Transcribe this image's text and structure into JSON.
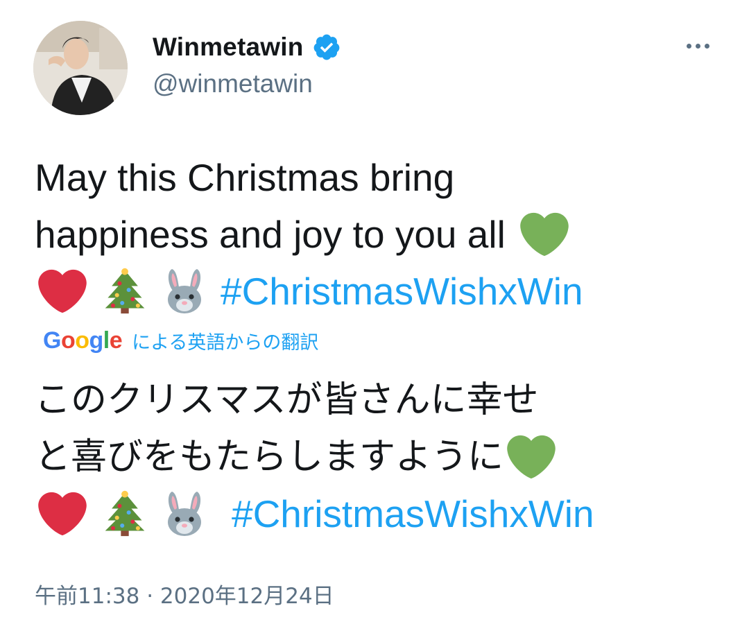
{
  "author": {
    "display_name": "Winmetawin",
    "handle": "@winmetawin",
    "verified": true
  },
  "tweet": {
    "original_lines": [
      "May this Christmas bring",
      "happiness and joy to you all"
    ],
    "hashtag": "#ChristmasWishxWin",
    "translation_credit": "による英語からの翻訳",
    "translation_provider": "Google",
    "translated_lines": [
      "このクリスマスが皆さんに幸せ",
      "と喜びをもたらしますように"
    ],
    "translated_hashtag": "#ChristmasWishxWin",
    "timestamp": "午前11:38 · 2020年12月24日",
    "emojis": [
      "green-heart",
      "red-heart",
      "christmas-tree",
      "rabbit-face"
    ]
  },
  "colors": {
    "link": "#1da1f2",
    "secondary_text": "#5b7083",
    "primary_text": "#14171a",
    "green_heart": "#78b159",
    "red_heart": "#dd2e44"
  }
}
